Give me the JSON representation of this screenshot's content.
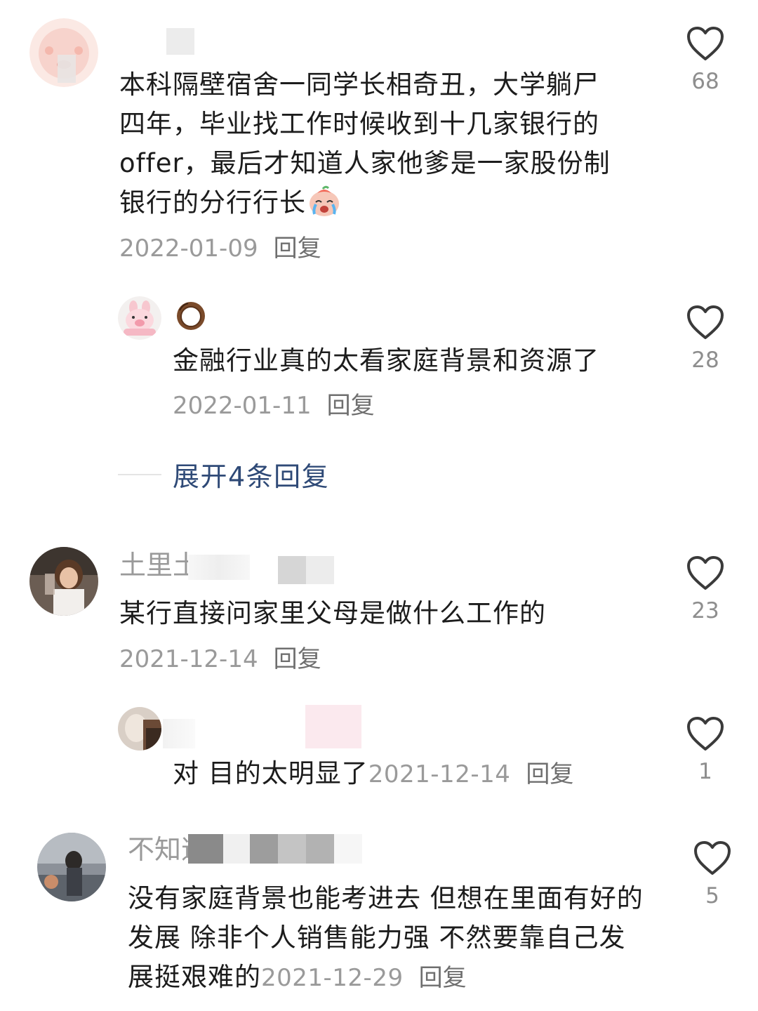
{
  "comments": [
    {
      "date": "2022-01-09",
      "reply_label": "回复",
      "likes": "68",
      "text": "本科隔壁宿舍一同学长相奇丑，大学躺尸四年，毕业找工作时候收到十几家银行的offer，最后才知道人家他爹是一家股份制银行的分行行长",
      "emoji": "crying-face-emoji"
    },
    {
      "date": "2022-01-11",
      "reply_label": "回复",
      "likes": "28",
      "text": "金融行业真的太看家庭背景和资源了",
      "user_badge": "coconut-icon"
    },
    {
      "expand_label": "展开4条回复"
    },
    {
      "username": "土里土",
      "date": "2021-12-14",
      "reply_label": "回复",
      "likes": "23",
      "text": "某行直接问家里父母是做什么工作的"
    },
    {
      "date": "2021-12-14",
      "reply_label": "回复",
      "likes": "1",
      "text": "对 目的太明显了"
    },
    {
      "username": "不知道",
      "date": "2021-12-29",
      "reply_label": "回复",
      "likes": "5",
      "text": "没有家庭背景也能考进去 但想在里面有好的发展 除非个人销售能力强 不然要靠自己发展挺艰难的"
    }
  ],
  "colors": {
    "text": "#1c1c1c",
    "meta": "#9a9a9a",
    "reply": "#6f6f6f",
    "expand": "#2f4a77",
    "heart": "#3a3a3a"
  }
}
